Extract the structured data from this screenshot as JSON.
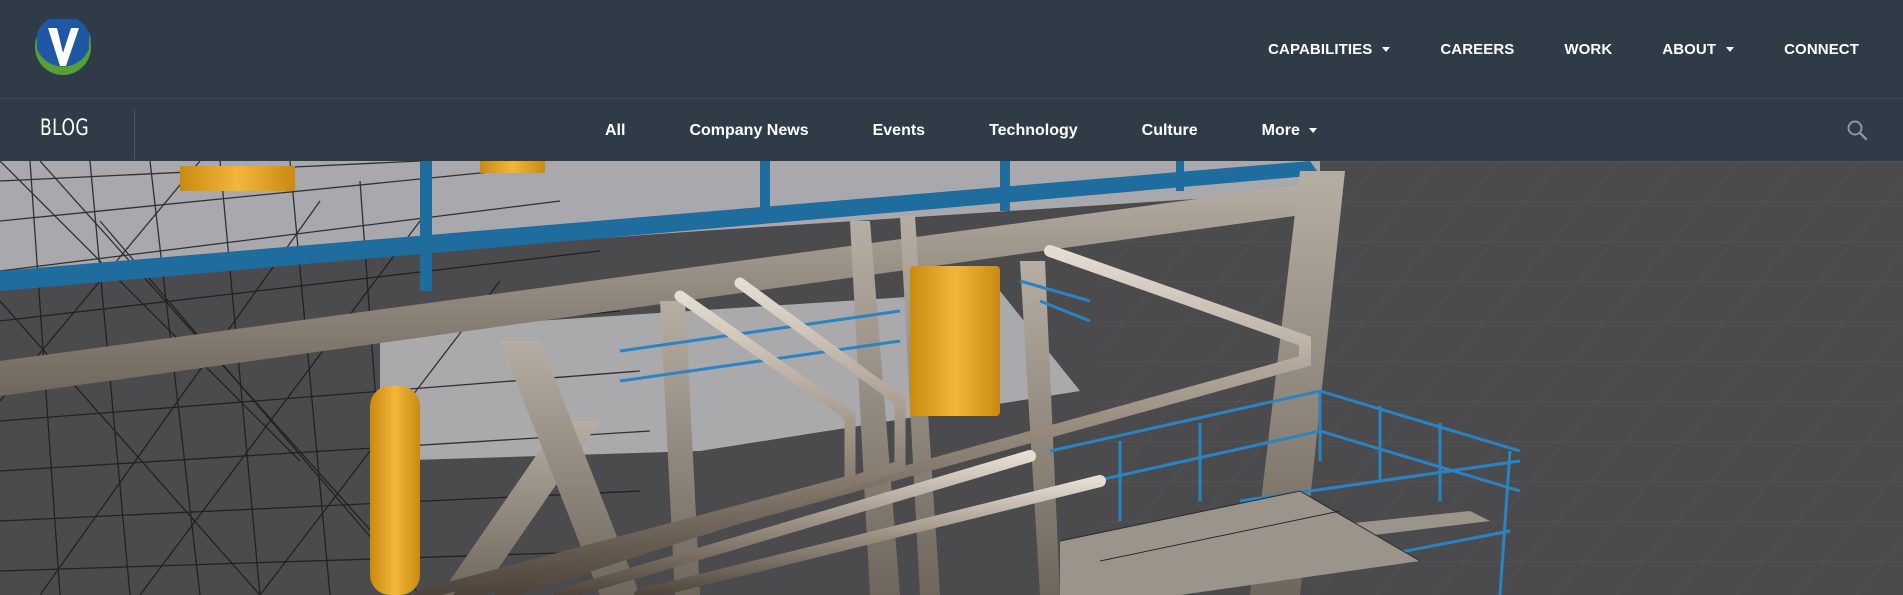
{
  "header": {
    "logo_icon": "v-logo-icon",
    "nav": [
      {
        "label": "CAPABILITIES",
        "has_dropdown": true
      },
      {
        "label": "CAREERS",
        "has_dropdown": false
      },
      {
        "label": "WORK",
        "has_dropdown": false
      },
      {
        "label": "ABOUT",
        "has_dropdown": true
      },
      {
        "label": "CONNECT",
        "has_dropdown": false
      }
    ]
  },
  "blogbar": {
    "title": "BLOG",
    "tabs": [
      {
        "label": "All"
      },
      {
        "label": "Company News"
      },
      {
        "label": "Events"
      },
      {
        "label": "Technology"
      },
      {
        "label": "Culture"
      },
      {
        "label": "More",
        "has_dropdown": true
      }
    ],
    "search_icon": "search-icon"
  },
  "colors": {
    "header_bg": "#2f3c47",
    "logo_blue": "#1f57a6",
    "logo_green": "#55a135",
    "steel_blue": "#1f6d9e",
    "safety_yellow": "#e8a625"
  }
}
